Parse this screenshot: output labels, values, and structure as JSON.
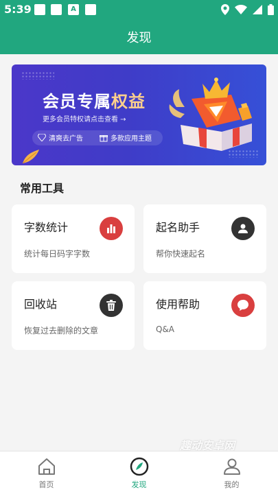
{
  "statusbar": {
    "time": "5:39",
    "a_icon": "A"
  },
  "header": {
    "title": "发现"
  },
  "banner": {
    "title_main": "会员专属",
    "title_highlight": "权益",
    "subtitle": "更多会员特权请点击查看 →",
    "pill1": "清爽去广告",
    "pill2": "多款应用主题"
  },
  "section": {
    "title": "常用工具"
  },
  "tools": [
    {
      "title": "字数统计",
      "desc": "统计每日码字字数",
      "icon": "bar-chart-icon",
      "color": "#d93f3f"
    },
    {
      "title": "起名助手",
      "desc": "帮你快速起名",
      "icon": "person-icon",
      "color": "#333333"
    },
    {
      "title": "回收站",
      "desc": "恢复过去删除的文章",
      "icon": "trash-icon",
      "color": "#333333"
    },
    {
      "title": "使用帮助",
      "desc": "Q&A",
      "icon": "help-bubble-icon",
      "color": "#d93f3f"
    }
  ],
  "watermark": "趣动安卓网",
  "nav": [
    {
      "label": "首页",
      "icon": "home-icon",
      "active": false
    },
    {
      "label": "发现",
      "icon": "compass-icon",
      "active": true
    },
    {
      "label": "我的",
      "icon": "user-icon",
      "active": false
    }
  ],
  "colors": {
    "primary": "#21a77f",
    "accent_red": "#d93f3f"
  }
}
